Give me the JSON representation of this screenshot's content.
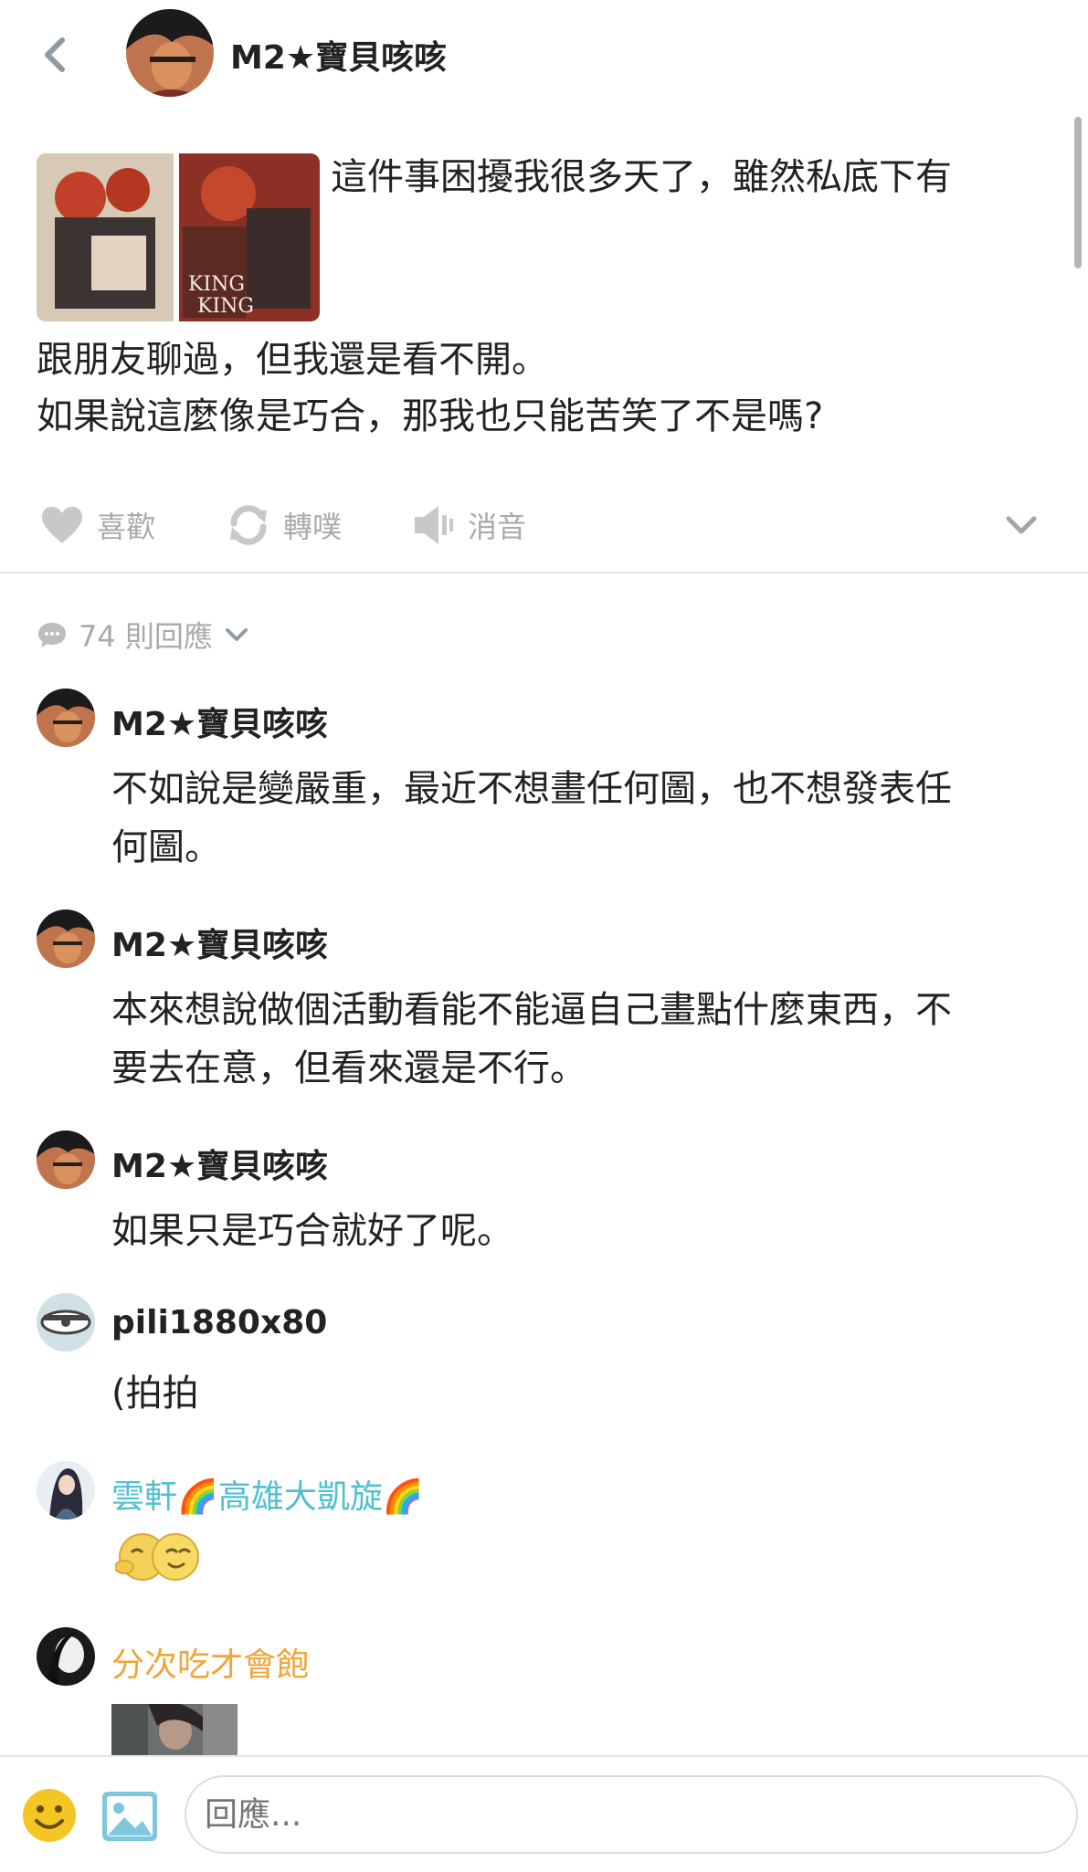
{
  "header": {
    "author": "M2★寶貝咳咳"
  },
  "post": {
    "lines": [
      "這件事困擾我很多天了，雖然私底下有",
      "跟朋友聊過，但我還是看不開。",
      "如果說這麼像是巧合，那我也只能苦笑了不是嗎?"
    ],
    "thumbnail_text": "KING KING"
  },
  "actions": {
    "like": "喜歡",
    "replurk": "轉噗",
    "mute": "消音"
  },
  "responses": {
    "count_label": "74 則回應",
    "items": [
      {
        "author": "M2★寶貝咳咳",
        "lines": [
          "不如說是變嚴重，最近不想畫任何圖，也不想發表任",
          "何圖。"
        ]
      },
      {
        "author": "M2★寶貝咳咳",
        "lines": [
          "本來想說做個活動看能不能逼自己畫點什麼東西，不",
          "要去在意，但看來還是不行。"
        ]
      },
      {
        "author": "M2★寶貝咳咳",
        "lines": [
          "如果只是巧合就好了呢。"
        ]
      },
      {
        "author": "pili1880x80",
        "lines": [
          "(拍拍"
        ]
      },
      {
        "author_a": "雲軒",
        "author_b": "高雄大凱旋",
        "author_color": "#4fc0d0",
        "emoji": "hugging-smileys"
      },
      {
        "author": "分次吃才會飽",
        "author_color": "#f0a43a"
      }
    ]
  },
  "composer": {
    "placeholder": "回應..."
  },
  "icons": {
    "back": "chevron-left-icon",
    "like": "heart-icon",
    "replurk": "refresh-icon",
    "mute": "speaker-mute-icon",
    "expand": "chevron-down-icon",
    "comments": "speech-bubble-icon",
    "emoji": "smiley-icon",
    "photo": "image-icon"
  },
  "colors": {
    "muted": "#a9a9a9",
    "cyan_name": "#4fc0d0",
    "orange_name": "#f0a43a"
  }
}
